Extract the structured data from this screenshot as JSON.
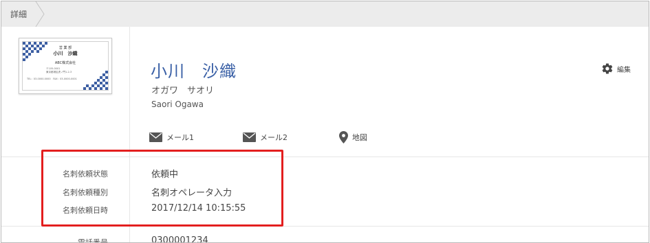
{
  "breadcrumb": {
    "label": "詳細"
  },
  "card": {
    "dept": "営 業 部",
    "name": "小川　沙織",
    "company": "ABC株式会社",
    "line1": "〒105-0001",
    "line2": "東京都港区虎ノ門1-2-3",
    "tel": "TEL：03-0000-0000　FAX：03-0000-0001"
  },
  "person": {
    "name_kanji": "小川　沙織",
    "name_kana": "オガワ　サオリ",
    "name_roman": "Saori Ogawa"
  },
  "actions": {
    "edit_label": "編集",
    "mail1_label": "メール1",
    "mail2_label": "メール2",
    "map_label": "地図"
  },
  "details": [
    {
      "label": "名刺依頼状態",
      "value": "依頼中"
    },
    {
      "label": "名刺依頼種別",
      "value": "名刺オペレータ入力"
    },
    {
      "label": "名刺依頼日時",
      "value": "2017/12/14 10:15:55"
    }
  ],
  "phone": {
    "label": "電話番号",
    "value": "0300001234"
  },
  "colors": {
    "accent": "#3a60a6",
    "highlight": "#e31e1e",
    "topbar": "#ececec",
    "card_pattern": "#3d5fa3"
  }
}
